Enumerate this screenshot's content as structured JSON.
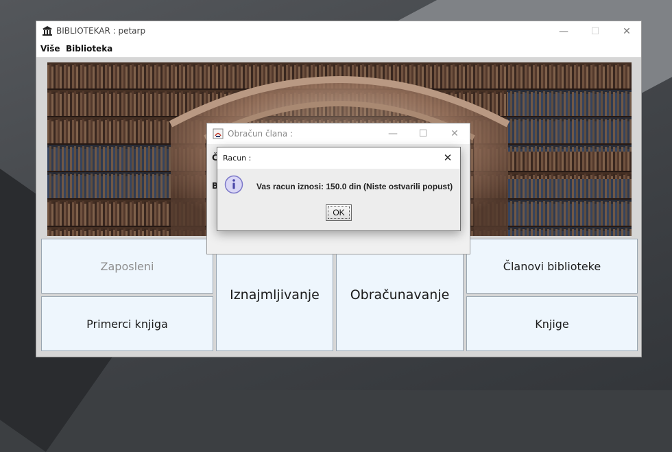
{
  "window": {
    "title": "BIBLIOTEKAR : petarp",
    "icon": "library-building-icon",
    "controls": [
      "—",
      "☐",
      "✕"
    ]
  },
  "menu": {
    "items": [
      "Više",
      "Biblioteka"
    ]
  },
  "tiles": {
    "zaposleni": "Zaposleni",
    "primerci": "Primerci knjiga",
    "iznajmljivanje": "Iznajmljivanje",
    "obracunavanje": "Obračunavanje",
    "clanovi": "Članovi biblioteke",
    "knjige": "Knjige"
  },
  "obracun_dialog": {
    "title": "Obračun člana :",
    "partial_label_1": "Č",
    "partial_label_2": "B"
  },
  "message_dialog": {
    "title": "Racun :",
    "text": "Vas racun iznosi:  150.0 din  (Niste ostvarili popust)",
    "ok_label": "OK",
    "icon": "information-icon",
    "close": "✕"
  },
  "colors": {
    "tile_bg": "#eef6fd",
    "disabled_text": "#8e8e8e",
    "info_icon": "#8a86d6"
  }
}
